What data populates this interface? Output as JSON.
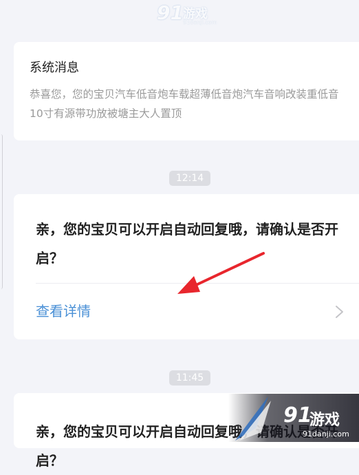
{
  "system_card": {
    "title": "系统消息",
    "body": "恭喜您，您的宝贝汽车低音炮车载超薄低音炮汽车音响改装重低音10寸有源带功放被塘主大人置顶"
  },
  "messages": [
    {
      "time": "12:14",
      "text": "亲，您的宝贝可以开启自动回复哦，请确认是否开启？",
      "link": "查看详情"
    },
    {
      "time": "11:45",
      "text": "亲，您的宝贝可以开启自动回复哦，请确认是否开启？"
    }
  ],
  "watermark": {
    "logo_num": "91",
    "logo_text": "游戏",
    "domain": "91danji.com"
  },
  "colors": {
    "background": "#f3f4f9",
    "link": "#4a90d6",
    "arrow": "#e8262d",
    "time_badge": "#dcdde2"
  },
  "icons": {
    "chevron": "chevron-right-icon",
    "annotation": "red-arrow-annotation"
  }
}
